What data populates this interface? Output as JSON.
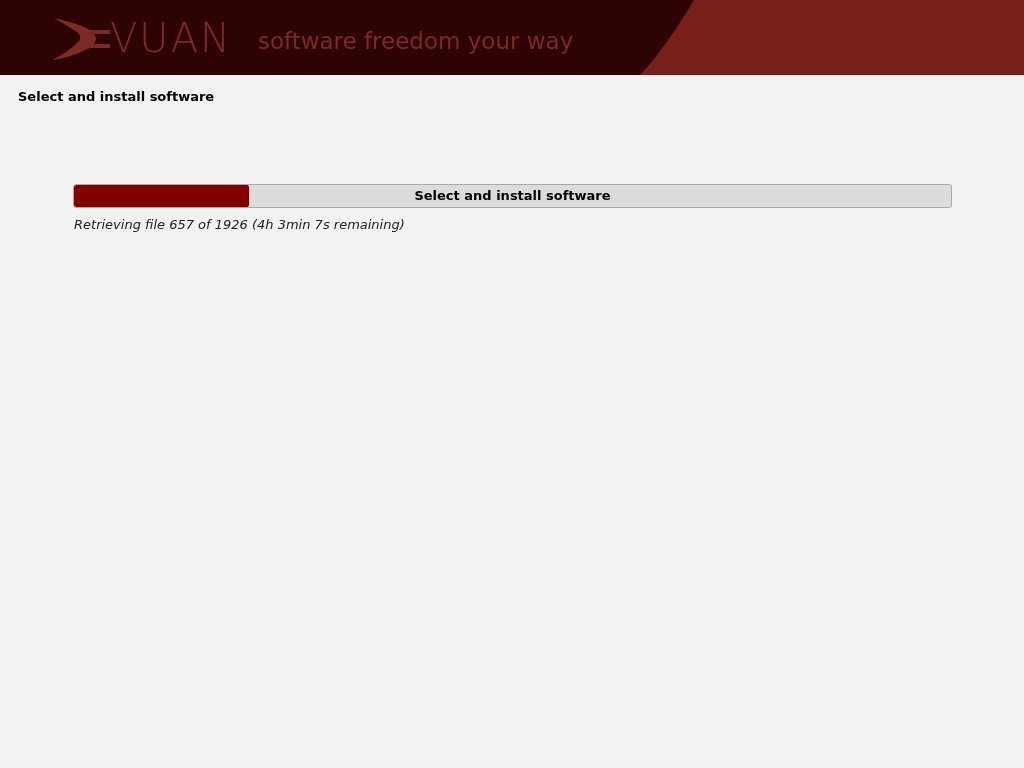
{
  "header": {
    "logo_text": "VUAN",
    "tagline": "software freedom your way"
  },
  "page_title": "Select and install software",
  "progress": {
    "label": "Select and install software",
    "level": 0.2,
    "status": "Retrieving file 657 of 1926 (4h 3min 7s remaining)"
  }
}
